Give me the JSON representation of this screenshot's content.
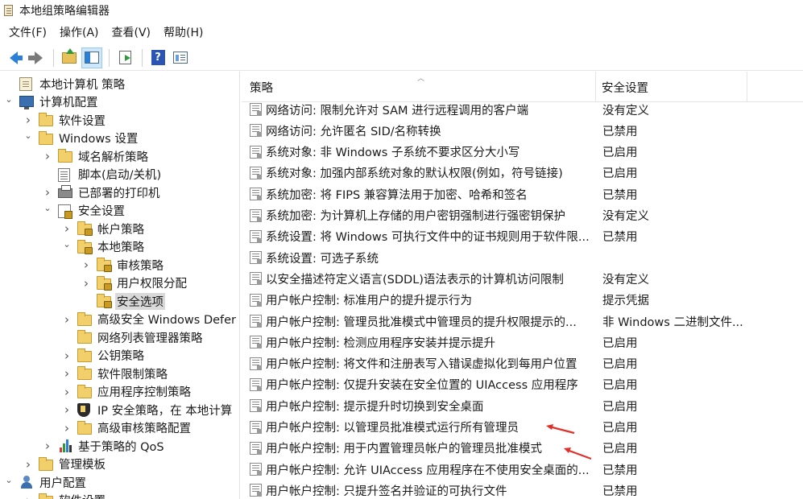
{
  "window": {
    "title": "本地组策略编辑器"
  },
  "menu": [
    {
      "label": "文件(F)"
    },
    {
      "label": "操作(A)"
    },
    {
      "label": "查看(V)"
    },
    {
      "label": "帮助(H)"
    }
  ],
  "toolbar": {
    "icons": [
      "back-icon",
      "forward-icon",
      "up-folder-icon",
      "show-hide-tree-icon",
      "export-list-icon",
      "help-icon",
      "view-icon"
    ]
  },
  "tree": [
    {
      "label": "本地计算机 策略",
      "toggle": "",
      "icon": "doc"
    },
    {
      "label": "计算机配置",
      "toggle": "v",
      "icon": "computer"
    },
    {
      "label": "软件设置",
      "toggle": ">",
      "icon": "folder"
    },
    {
      "label": "Windows 设置",
      "toggle": "v",
      "icon": "folder"
    },
    {
      "label": "域名解析策略",
      "toggle": ">",
      "icon": "folder"
    },
    {
      "label": "脚本(启动/关机)",
      "toggle": "",
      "icon": "script"
    },
    {
      "label": "已部署的打印机",
      "toggle": ">",
      "icon": "printer"
    },
    {
      "label": "安全设置",
      "toggle": "v",
      "icon": "security"
    },
    {
      "label": "帐户策略",
      "toggle": ">",
      "icon": "lockfolder"
    },
    {
      "label": "本地策略",
      "toggle": "v",
      "icon": "lockfolder"
    },
    {
      "label": "审核策略",
      "toggle": ">",
      "icon": "lockfolder"
    },
    {
      "label": "用户权限分配",
      "toggle": ">",
      "icon": "lockfolder"
    },
    {
      "label": "安全选项",
      "toggle": "",
      "icon": "lockfolder"
    },
    {
      "label": "高级安全 Windows Defer",
      "toggle": ">",
      "icon": "folder"
    },
    {
      "label": "网络列表管理器策略",
      "toggle": "",
      "icon": "folder"
    },
    {
      "label": "公钥策略",
      "toggle": ">",
      "icon": "folder"
    },
    {
      "label": "软件限制策略",
      "toggle": ">",
      "icon": "folder"
    },
    {
      "label": "应用程序控制策略",
      "toggle": ">",
      "icon": "folder"
    },
    {
      "label": "IP 安全策略，在 本地计算",
      "toggle": ">",
      "icon": "shield"
    },
    {
      "label": "高级审核策略配置",
      "toggle": ">",
      "icon": "folder"
    },
    {
      "label": "基于策略的 QoS",
      "toggle": ">",
      "icon": "chart"
    },
    {
      "label": "管理模板",
      "toggle": ">",
      "icon": "folder"
    },
    {
      "label": "用户配置",
      "toggle": "v",
      "icon": "users"
    },
    {
      "label": "软件设置",
      "toggle": ">",
      "icon": "folder"
    }
  ],
  "list": {
    "headers": {
      "policy": "策略",
      "setting": "安全设置"
    },
    "rows": [
      {
        "policy": "网络访问: 限制允许对 SAM 进行远程调用的客户端",
        "setting": "没有定义"
      },
      {
        "policy": "网络访问: 允许匿名 SID/名称转换",
        "setting": "已禁用"
      },
      {
        "policy": "系统对象: 非 Windows 子系统不要求区分大小写",
        "setting": "已启用"
      },
      {
        "policy": "系统对象: 加强内部系统对象的默认权限(例如，符号链接)",
        "setting": "已启用"
      },
      {
        "policy": "系统加密: 将 FIPS 兼容算法用于加密、哈希和签名",
        "setting": "已禁用"
      },
      {
        "policy": "系统加密: 为计算机上存储的用户密钥强制进行强密钥保护",
        "setting": "没有定义"
      },
      {
        "policy": "系统设置: 将 Windows 可执行文件中的证书规则用于软件限...",
        "setting": "已禁用"
      },
      {
        "policy": "系统设置: 可选子系统",
        "setting": ""
      },
      {
        "policy": "以安全描述符定义语言(SDDL)语法表示的计算机访问限制",
        "setting": "没有定义"
      },
      {
        "policy": "用户帐户控制: 标准用户的提升提示行为",
        "setting": "提示凭据"
      },
      {
        "policy": "用户帐户控制: 管理员批准模式中管理员的提升权限提示的...",
        "setting": "非 Windows 二进制文件..."
      },
      {
        "policy": "用户帐户控制: 检测应用程序安装并提示提升",
        "setting": "已启用"
      },
      {
        "policy": "用户帐户控制: 将文件和注册表写入错误虚拟化到每用户位置",
        "setting": "已启用"
      },
      {
        "policy": "用户帐户控制: 仅提升安装在安全位置的 UIAccess 应用程序",
        "setting": "已启用"
      },
      {
        "policy": "用户帐户控制: 提示提升时切换到安全桌面",
        "setting": "已启用"
      },
      {
        "policy": "用户帐户控制: 以管理员批准模式运行所有管理员",
        "setting": "已启用"
      },
      {
        "policy": "用户帐户控制: 用于内置管理员帐户的管理员批准模式",
        "setting": "已启用"
      },
      {
        "policy": "用户帐户控制: 允许 UIAccess 应用程序在不使用安全桌面的...",
        "setting": "已禁用"
      },
      {
        "policy": "用户帐户控制: 只提升签名并验证的可执行文件",
        "setting": "已禁用"
      }
    ]
  },
  "annotation_color": "#e0302a"
}
